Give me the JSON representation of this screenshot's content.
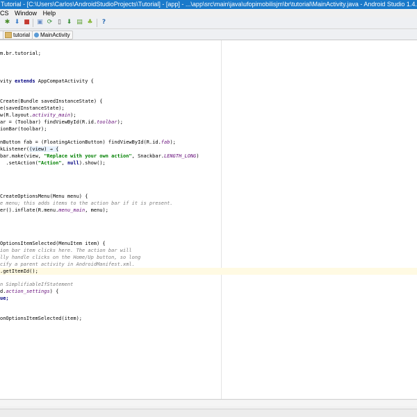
{
  "window": {
    "title": "Tutorial - [C:\\Users\\Carlos\\AndroidStudioProjects\\Tutorial] - [app] - ...\\app\\src\\main\\java\\ufopimobilisjm\\br\\tutorial\\MainActivity.java - Android Studio 1.4.1"
  },
  "menu": {
    "items": [
      "CS",
      "Window",
      "Help"
    ]
  },
  "toolbar": {
    "icons": [
      "bug-icon",
      "attach-icon",
      "stop-icon",
      "layout-icon",
      "sync-icon",
      "device-icon",
      "sdk-manager-icon",
      "avd-icon",
      "android-icon",
      "help-icon"
    ],
    "help_label": "?"
  },
  "breadcrumb": {
    "tutorial": "tutorial",
    "main_activity": "MainActivity"
  },
  "code": {
    "l1": "m.br.tutorial;",
    "l2_a": "vity ",
    "l2_kw": "extends",
    "l2_b": " AppCompatActivity {",
    "l3": "Create(Bundle savedInstanceState) {",
    "l4": "e(savedInstanceState);",
    "l5_a": "w(R.layout.",
    "l5_f": "activity_main",
    "l5_b": ");",
    "l6_a": "ar = (Toolbar) findViewById(R.id.",
    "l6_f": "toolbar",
    "l6_b": ");",
    "l7": "ionBar(toolbar);",
    "l8_a": "nButton fab = (FloatingActionButton) findViewById(R.id.",
    "l8_f": "fab",
    "l8_b": ");",
    "l9_a": "kListener(",
    "l9_b": "(view) → {",
    "l10_a": "bar.make(view, ",
    "l10_s": "\"Replace with your own action\"",
    "l10_b": ", Snackbar.",
    "l10_f": "LENGTH_LONG",
    "l10_c": ")",
    "l11_a": "  .setAction(",
    "l11_s": "\"Action\"",
    "l11_b": ", ",
    "l11_kw": "null",
    "l11_c": ").show();",
    "l12": "CreateOptionsMenu(Menu menu) {",
    "l13": "e menu; this adds items to the action bar if it is present.",
    "l14_a": "er().inflate(R.menu.",
    "l14_f": "menu_main",
    "l14_b": ", menu);",
    "l15": "OptionsItemSelected(MenuItem item) {",
    "l16": "ion bar item clicks here. The action bar will",
    "l17": "lly handle clicks on the Home/Up button, so long",
    "l18": "cify a parent activity in AndroidManifest.xml.",
    "l19": ".getItemId();",
    "l20": "n SimplifiableIfStatement",
    "l21_a": "d.",
    "l21_f": "action_settings",
    "l21_b": ") {",
    "l22": "ue;",
    "l23": "onOptionsItemSelected(item);"
  }
}
